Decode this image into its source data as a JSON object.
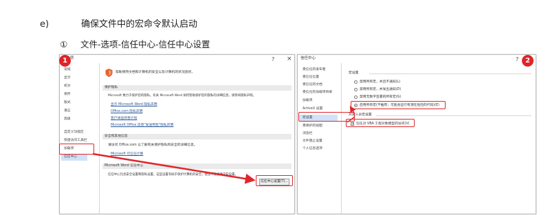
{
  "heading": {
    "marker": "e)",
    "text": "确保文件中的宏命令默认启动"
  },
  "step": {
    "marker": "①",
    "text": "文件-选项-信任中心-信任中心设置"
  },
  "left_window": {
    "title": "选项",
    "controls": [
      "?",
      "×"
    ],
    "nav": [
      "常规",
      "显示",
      "校对",
      "保存",
      "版式",
      "语言",
      "高级",
      "自定义功能区",
      "快速访问工具栏",
      "加载项",
      "信任中心"
    ],
    "header_text": "帮助保持文档和计算机的安全以及计算机的状况良好。",
    "section_privacy": "保护隐私",
    "privacy_text": "Microsoft 致力于保护您的隐私。有关 Microsoft Word 如何帮助保护您的隐私的详细信息，请参阅隐私声明。",
    "links": [
      "显示 Microsoft Word 隐私声明",
      "Office.com 隐私声明",
      "客户体验改善计划",
      "Microsoft Office 反馈\"发送笑脸\"隐私声明"
    ],
    "section_security": "安全和其他信息",
    "security_text": "请访问 Office.com 以了解有关保护隐私和安全的详细信息。",
    "security_link": "Microsoft 可信任计算",
    "section_trust": "Microsoft Word 信任中心",
    "trust_text": "信任中心包含安全设置和隐私设置。这些设置有助于保护计算机的安全。建议不要更改这些设置。",
    "trust_button": "信任中心设置(T)..."
  },
  "right_window": {
    "title": "信任中心",
    "controls": [
      "?"
    ],
    "nav": [
      "受信任的发布者",
      "受信任位置",
      "受信任的文档",
      "受信任的加载项目录",
      "加载项",
      "ActiveX 设置",
      "宏设置",
      "受保护的视图",
      "消息栏",
      "文件阻止设置",
      "个人信息选项"
    ],
    "section_macro": "宏设置",
    "options": [
      "禁用所有宏，并且不通知(L)",
      "禁用所有宏，并发出通知(D)",
      "禁用无数字签署的所有宏(G)",
      "启用所有宏(不推荐；可能会运行有潜在危险的代码)(E)"
    ],
    "section_dev": "开发人员宏设置",
    "checkbox_label": "信任对 VBA 工程对象模型的访问(V)"
  },
  "badges": [
    "1",
    "2"
  ],
  "colors": {
    "annotation_red": "#e0262b",
    "selection_blue": "#cfe2f7",
    "link_blue": "#2b5797"
  }
}
